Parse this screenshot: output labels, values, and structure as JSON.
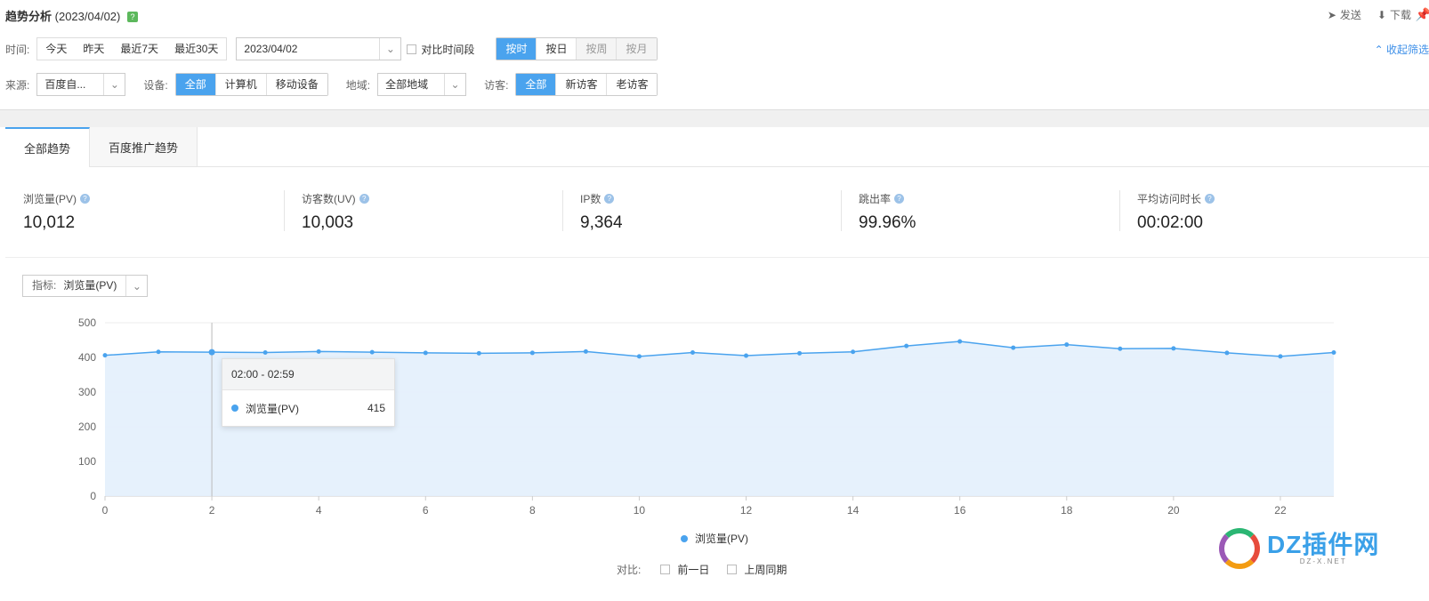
{
  "header": {
    "title": "趋势分析",
    "date": "(2023/04/02)",
    "help": "?",
    "send": "发送",
    "download": "下载"
  },
  "filters": {
    "time_label": "时间:",
    "time_options": [
      "今天",
      "昨天",
      "最近7天",
      "最近30天"
    ],
    "date_value": "2023/04/02",
    "compare_period": "对比时间段",
    "granularity": [
      "按时",
      "按日",
      "按周",
      "按月"
    ],
    "collapse": "收起筛选",
    "source_label": "来源:",
    "source_value": "百度自...",
    "device_label": "设备:",
    "device_options": [
      "全部",
      "计算机",
      "移动设备"
    ],
    "region_label": "地域:",
    "region_value": "全部地域",
    "visitor_label": "访客:",
    "visitor_options": [
      "全部",
      "新访客",
      "老访客"
    ]
  },
  "tabs": [
    "全部趋势",
    "百度推广趋势"
  ],
  "metrics": [
    {
      "label": "浏览量(PV)",
      "value": "10,012"
    },
    {
      "label": "访客数(UV)",
      "value": "10,003"
    },
    {
      "label": "IP数",
      "value": "9,364"
    },
    {
      "label": "跳出率",
      "value": "99.96%"
    },
    {
      "label": "平均访问时长",
      "value": "00:02:00"
    }
  ],
  "indicator": {
    "label": "指标:",
    "value": "浏览量(PV)"
  },
  "tooltip": {
    "title": "02:00 - 02:59",
    "series": "浏览量(PV)",
    "value": "415"
  },
  "compare": {
    "label": "对比:",
    "options": [
      "前一日",
      "上周同期"
    ]
  },
  "watermark": {
    "text": "DZ插件网",
    "sub": "DZ-X.NET"
  },
  "colors": {
    "accent": "#4aa3ee",
    "area": "#e3f0fc"
  },
  "chart_data": {
    "type": "area",
    "x": [
      0,
      1,
      2,
      3,
      4,
      5,
      6,
      7,
      8,
      9,
      10,
      11,
      12,
      13,
      14,
      15,
      16,
      17,
      18,
      19,
      20,
      21,
      22,
      23
    ],
    "x_ticks": [
      "0",
      "2",
      "4",
      "6",
      "8",
      "10",
      "12",
      "14",
      "16",
      "18",
      "20",
      "22"
    ],
    "y_ticks": [
      "0",
      "100",
      "200",
      "300",
      "400",
      "500"
    ],
    "ylim": [
      0,
      500
    ],
    "series": [
      {
        "name": "浏览量(PV)",
        "values": [
          406,
          416,
          415,
          414,
          417,
          415,
          413,
          412,
          413,
          417,
          403,
          414,
          405,
          412,
          416,
          433,
          446,
          428,
          437,
          425,
          426,
          413,
          403,
          414
        ]
      }
    ],
    "highlight_x": 2,
    "legend_position": "bottom"
  }
}
